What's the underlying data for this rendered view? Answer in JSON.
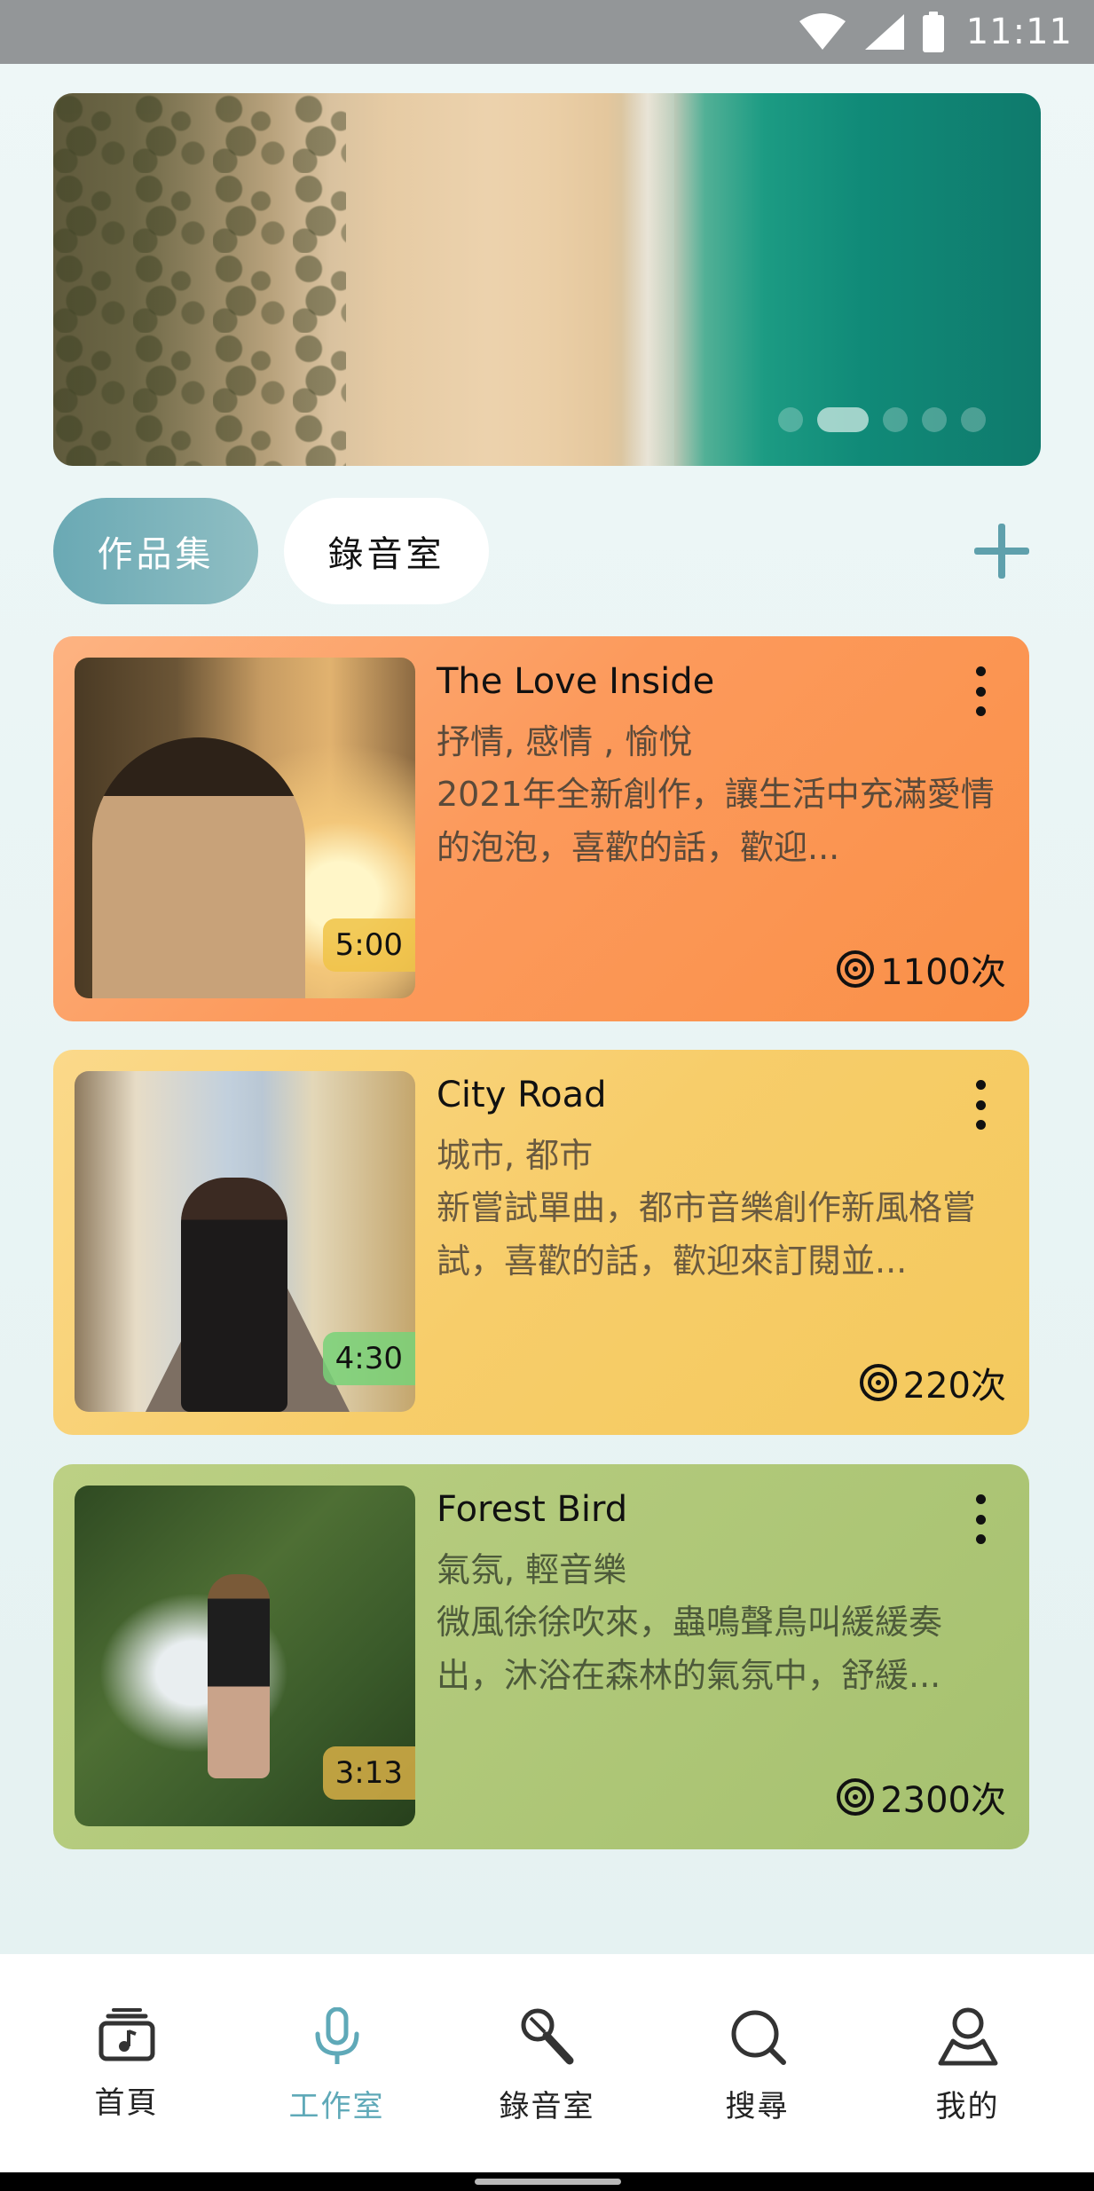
{
  "status_bar": {
    "time": "11:11"
  },
  "banner": {
    "page_count": 5,
    "active_index": 1
  },
  "tabs": [
    {
      "label": "作品集",
      "selected": true
    },
    {
      "label": "錄音室",
      "selected": false
    }
  ],
  "add_icon": "plus-icon",
  "songs": [
    {
      "title": "The Love Inside",
      "tags": "抒情, 感情 , 愉悅",
      "description": "2021年全新創作，讓生活中充滿愛情的泡泡，喜歡的話，歡迎...",
      "duration": "5:00",
      "plays": "1100次",
      "color": "#fc9a5c"
    },
    {
      "title": "City Road",
      "tags": "城市, 都市",
      "description": "新嘗試單曲，都市音樂創作新風格嘗試，喜歡的話，歡迎來訂閱並...",
      "duration": "4:30",
      "plays": "220次",
      "color": "#f7cd6a"
    },
    {
      "title": "Forest Bird",
      "tags": "氣氛, 輕音樂",
      "description": "微風徐徐吹來，蟲鳴聲鳥叫緩緩奏出，沐浴在森林的氣氛中，舒緩...",
      "duration": "3:13",
      "plays": "2300次",
      "color": "#b0c879"
    }
  ],
  "nav": [
    {
      "label": "首頁",
      "icon": "music-stack-icon",
      "active": false
    },
    {
      "label": "工作室",
      "icon": "microphone-icon",
      "active": true
    },
    {
      "label": "錄音室",
      "icon": "handheld-mic-icon",
      "active": false
    },
    {
      "label": "搜尋",
      "icon": "search-icon",
      "active": false
    },
    {
      "label": "我的",
      "icon": "profile-icon",
      "active": false
    }
  ],
  "colors": {
    "accent": "#5fa9b8",
    "status_bar": "#939698"
  }
}
